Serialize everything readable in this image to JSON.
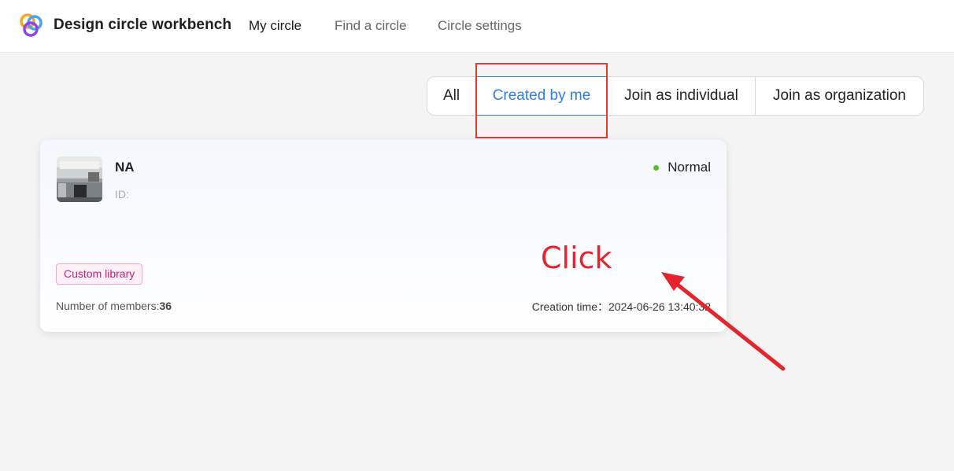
{
  "app": {
    "title": "Design circle workbench"
  },
  "nav": [
    {
      "label": "My circle",
      "active": true
    },
    {
      "label": "Find a circle",
      "active": false
    },
    {
      "label": "Circle settings",
      "active": false
    }
  ],
  "tabs": [
    {
      "label": "All"
    },
    {
      "label": "Created by me",
      "selected": true
    },
    {
      "label": "Join as individual"
    },
    {
      "label": "Join as organization"
    }
  ],
  "card": {
    "name": "NA",
    "id_label": "ID:",
    "status": "Normal",
    "tag": "Custom library",
    "members_label": "Number of members:",
    "members_count": "36",
    "creation_label": "Creation time：",
    "creation_time": "2024-06-26 13:40:32"
  },
  "annotation": {
    "text": "Click"
  },
  "colors": {
    "accent": "#2f7fd9",
    "status_ok": "#52c41a",
    "annotation_red": "#e3262d",
    "tag_text": "#c41d7f"
  }
}
